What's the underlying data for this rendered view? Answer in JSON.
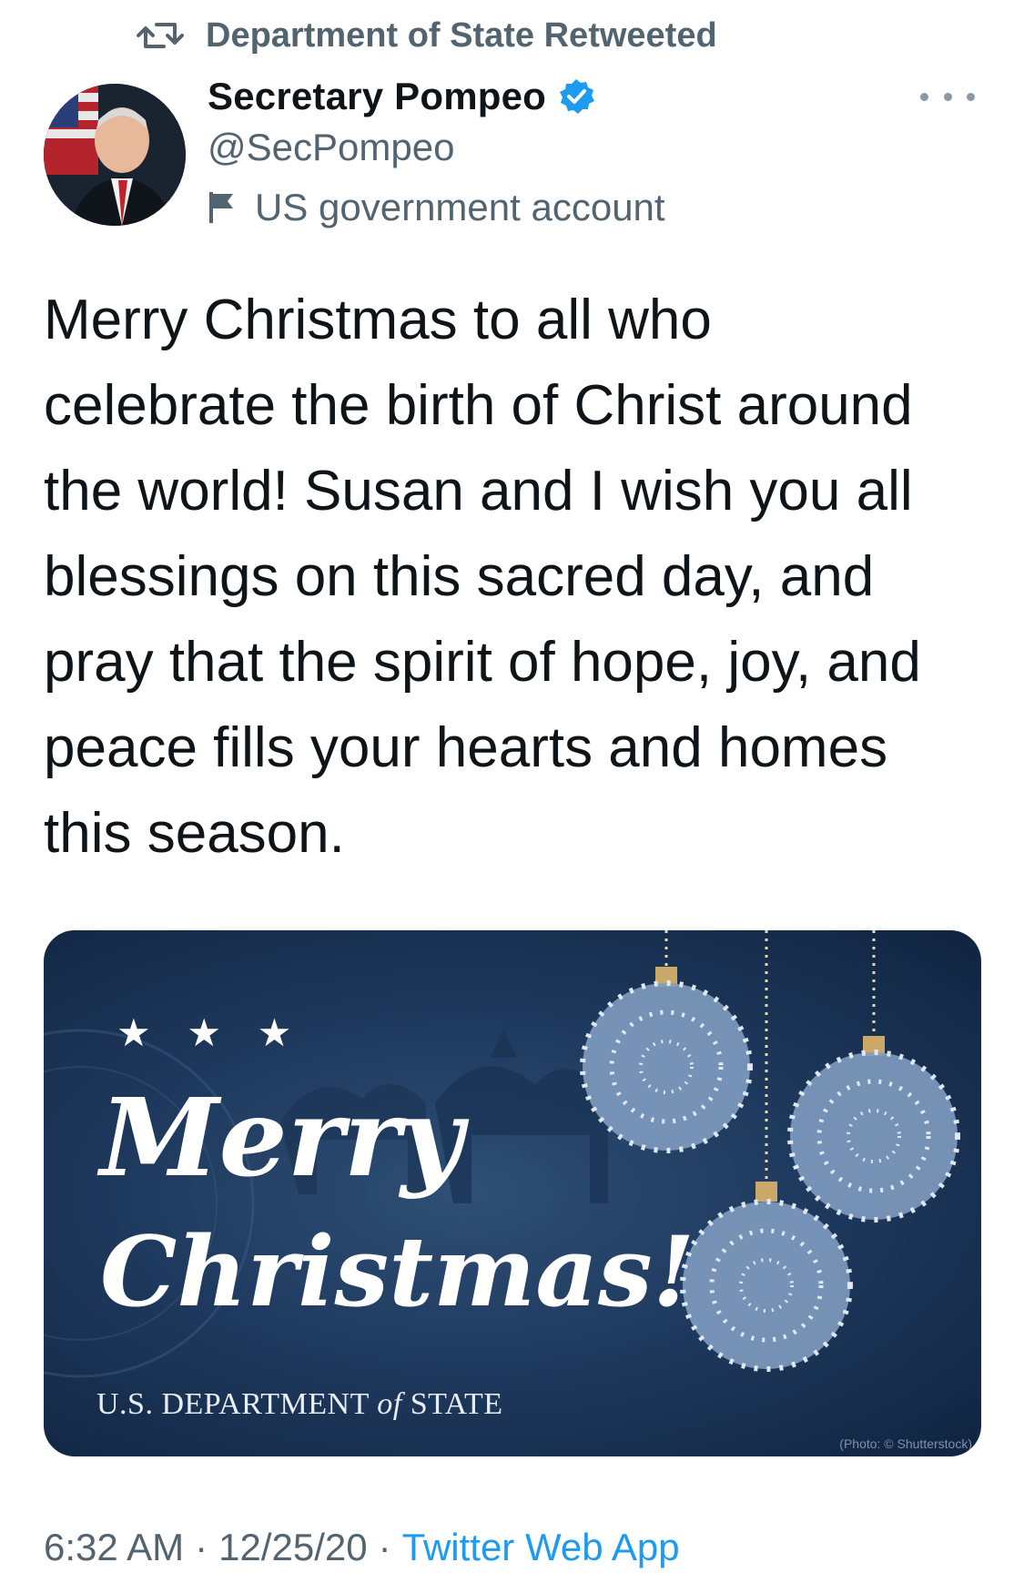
{
  "retweet": {
    "label": "Department of State Retweeted",
    "icon": "retweet-icon"
  },
  "author": {
    "name": "Secretary Pompeo",
    "handle": "@SecPompeo",
    "verified_icon": "verified-badge-icon",
    "label_icon": "flag-icon",
    "label": "US government account"
  },
  "more_icon": "more-options-icon",
  "tweet": {
    "text_lines": [
      "Merry Christmas to all who",
      "celebrate the birth of Christ around",
      "the world! Susan and I wish you all",
      "blessings on this sacred day, and",
      "pray that the spirit of hope, joy, and",
      "peace fills your hearts and homes",
      "this season."
    ]
  },
  "media": {
    "stars": "★ ★ ★",
    "merry": "Merry",
    "christmas": "Christmas!",
    "dept_prefix": "U.S. DEPARTMENT",
    "dept_of": "of",
    "dept_suffix": "STATE",
    "credit": "(Photo: © Shutterstock)"
  },
  "meta": {
    "time": "6:32 AM",
    "sep1": "·",
    "date": "12/25/20",
    "sep2": "·",
    "app": "Twitter Web App"
  },
  "colors": {
    "accent": "#1d9bf0",
    "secondary_text": "#536471",
    "card_bg": "#1f3a5f"
  }
}
